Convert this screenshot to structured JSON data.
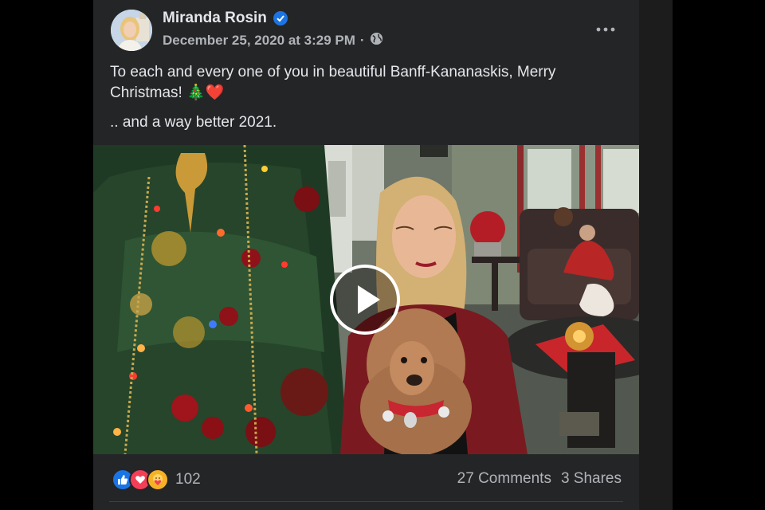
{
  "post": {
    "author": "Miranda Rosin",
    "timestamp": "December 25, 2020 at 3:29 PM",
    "separator": "·",
    "privacy_icon": "globe-icon",
    "verified_icon": "verified-badge-icon",
    "more_icon": "more-options-icon",
    "text_line1": "To each and every one of you in beautiful Banff-Kananaskis, Merry Christmas! 🎄❤️",
    "text_line2": ".. and a way better 2021."
  },
  "video": {
    "play_icon": "play-icon"
  },
  "footer": {
    "reaction_icons": [
      "like-icon",
      "love-icon",
      "care-icon"
    ],
    "reaction_count": "102",
    "comments": "27 Comments",
    "shares": "3 Shares"
  },
  "colors": {
    "card_bg": "#242526",
    "text_primary": "#e4e6eb",
    "text_secondary": "#b0b3b8",
    "brand_blue": "#1b74e4",
    "love_red": "#f33e58",
    "care_yellow": "#f7b125"
  }
}
